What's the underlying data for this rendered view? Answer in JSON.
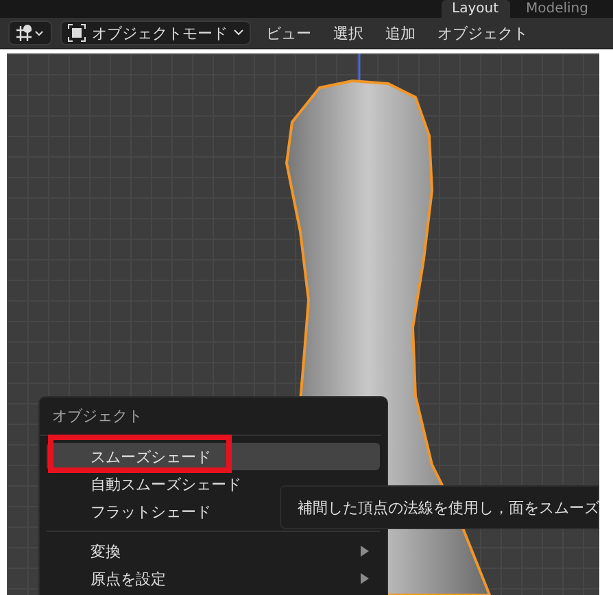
{
  "workspace_tabs": [
    {
      "label": "Layout",
      "selected": true
    },
    {
      "label": "Modeling",
      "selected": false
    }
  ],
  "header": {
    "mode": "オブジェクトモード",
    "menus": [
      "ビュー",
      "選択",
      "追加",
      "オブジェクト"
    ]
  },
  "context_menu": {
    "title": "オブジェクト",
    "items": [
      {
        "kind": "item",
        "label": "スムーズシェード",
        "selected": true,
        "annotated": true
      },
      {
        "kind": "item",
        "label": "自動スムーズシェード",
        "selected": false,
        "annotated": false
      },
      {
        "kind": "item",
        "label": "フラットシェード",
        "selected": false,
        "annotated": false
      },
      {
        "kind": "separator"
      },
      {
        "kind": "submenu",
        "label": "変換",
        "selected": false,
        "annotated": false
      },
      {
        "kind": "submenu",
        "label": "原点を設定",
        "selected": false,
        "annotated": false
      }
    ]
  },
  "tooltip": "補間した頂点の法線を使用し，面をスムーズ"
}
